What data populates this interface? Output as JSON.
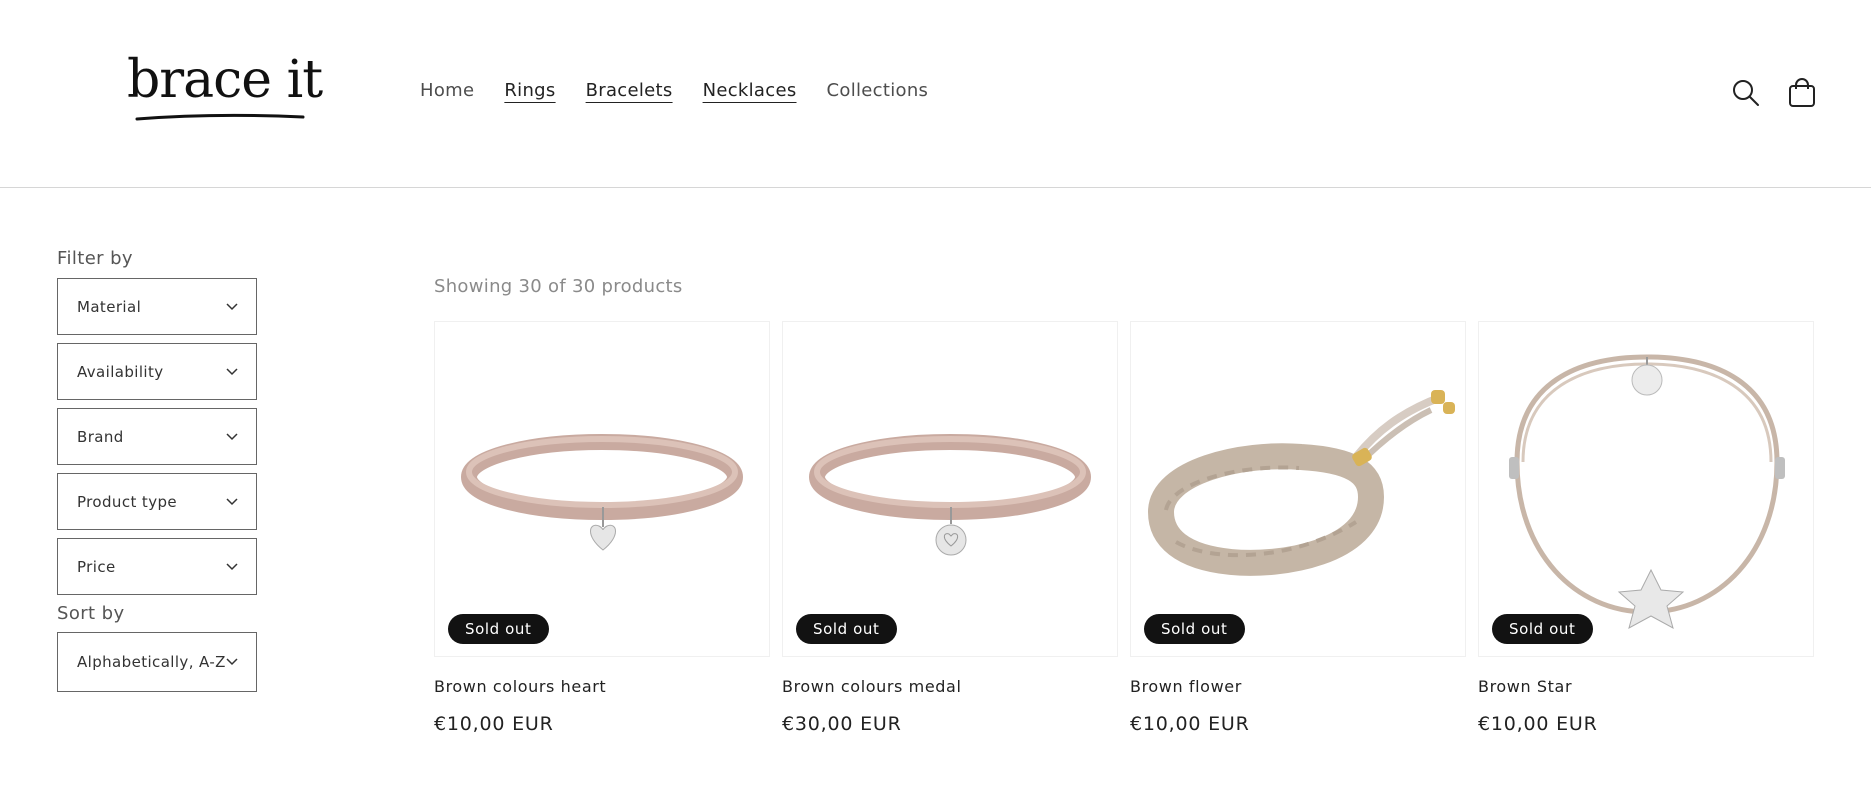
{
  "header": {
    "logo_text": "brace it",
    "nav": [
      {
        "label": "Home",
        "underlined": false
      },
      {
        "label": "Rings",
        "underlined": true
      },
      {
        "label": "Bracelets",
        "underlined": true
      },
      {
        "label": "Necklaces",
        "underlined": true
      },
      {
        "label": "Collections",
        "underlined": false
      }
    ],
    "icons": [
      "search-icon",
      "cart-icon"
    ]
  },
  "sidebar": {
    "filter_heading": "Filter by",
    "filters": [
      "Material",
      "Availability",
      "Brand",
      "Product type",
      "Price"
    ],
    "sort_heading": "Sort by",
    "sort_selected": "Alphabetically, A-Z"
  },
  "results": {
    "count_text": "Showing 30 of 30 products"
  },
  "products": [
    {
      "title": "Brown colours heart",
      "price": "€10,00 EUR",
      "badge": "Sold out",
      "image": "pink-double-bracelet-heart-charm"
    },
    {
      "title": "Brown colours medal",
      "price": "€30,00 EUR",
      "badge": "Sold out",
      "image": "pink-double-bracelet-medal-charm"
    },
    {
      "title": "Brown flower",
      "price": "€10,00 EUR",
      "badge": "Sold out",
      "image": "beige-braided-bracelet"
    },
    {
      "title": "Brown Star",
      "price": "€10,00 EUR",
      "badge": "Sold out",
      "image": "beige-cord-bracelet-star-charm"
    }
  ],
  "colors": {
    "badge_bg": "#121212",
    "divider": "#d6d6d6",
    "pink_band": "#c9aaa0",
    "beige_cord": "#c8b6a8"
  }
}
